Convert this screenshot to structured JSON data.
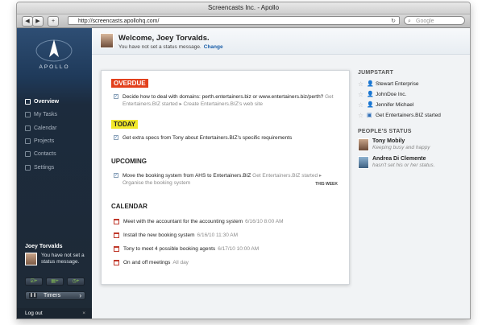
{
  "window": {
    "title": "Screencasts Inc. - Apollo"
  },
  "browser": {
    "url": "http://screencasts.apollohq.com/",
    "search_placeholder": "Google"
  },
  "sidebar": {
    "logo": "APOLLO",
    "items": [
      {
        "label": "Overview",
        "icon": "overview-icon",
        "active": true
      },
      {
        "label": "My Tasks",
        "icon": "tasks-icon"
      },
      {
        "label": "Calendar",
        "icon": "calendar-icon"
      },
      {
        "label": "Projects",
        "icon": "projects-icon"
      },
      {
        "label": "Contacts",
        "icon": "contacts-icon"
      },
      {
        "label": "Settings",
        "icon": "settings-icon"
      }
    ],
    "user": {
      "name": "Joey Torvalds",
      "message": "You have not set a status message."
    },
    "timers_label": "Timers",
    "logout_label": "Log out",
    "logout_close": "×"
  },
  "header": {
    "welcome": "Welcome, Joey Torvalds.",
    "status_text": "You have not set a status message.",
    "change_link": "Change"
  },
  "overdue": {
    "title": "OVERDUE",
    "tasks": [
      {
        "text": "Decide how to deal with domains: perth.entertainers.biz or www.entertainers.biz/perth?",
        "meta": "Get Entertainers.BIZ started ▸ Create Entertainers.BIZ's web site"
      }
    ]
  },
  "today": {
    "title": "TODAY",
    "tasks": [
      {
        "text": "Get extra specs from Tony about Entertainers.BIZ's specific requirements"
      }
    ]
  },
  "upcoming": {
    "title": "UPCOMING",
    "tasks": [
      {
        "text": "Move the booking system from AHS to Entertainers.BIZ",
        "meta": "Get Entertainers.BIZ started ▸ Organise the booking system",
        "badge": "THIS WEEK"
      }
    ]
  },
  "calendar": {
    "title": "CALENDAR",
    "events": [
      {
        "text": "Meet with the accountant for the accounting system",
        "when": "6/16/10 8:00 AM"
      },
      {
        "text": "Install the new booking system",
        "when": "6/16/10 11:30 AM"
      },
      {
        "text": "Tony to meet 4 possible booking agents",
        "when": "6/17/10 10:00 AM"
      },
      {
        "text": "On and off meetings",
        "when": "All day"
      }
    ]
  },
  "jumpstart": {
    "title": "JUMPSTART",
    "items": [
      {
        "label": "Stewart Enterprise",
        "icon": "person-icon"
      },
      {
        "label": "JohnDoe Inc.",
        "icon": "person-icon"
      },
      {
        "label": "Jennifer Michael",
        "icon": "person-icon"
      },
      {
        "label": "Get Entertainers.BIZ started",
        "icon": "project-icon"
      }
    ]
  },
  "people_status": {
    "title": "PEOPLE'S STATUS",
    "people": [
      {
        "name": "Tony Mobily",
        "status": "Keeping busy and happy"
      },
      {
        "name": "Andrea Di Clemente",
        "status": "hasn't set his or her status."
      }
    ]
  },
  "colors": {
    "overdue": "#e2401c",
    "today": "#f2e82a",
    "link": "#1a5ea8",
    "sidebar": "#1f3a5a"
  }
}
